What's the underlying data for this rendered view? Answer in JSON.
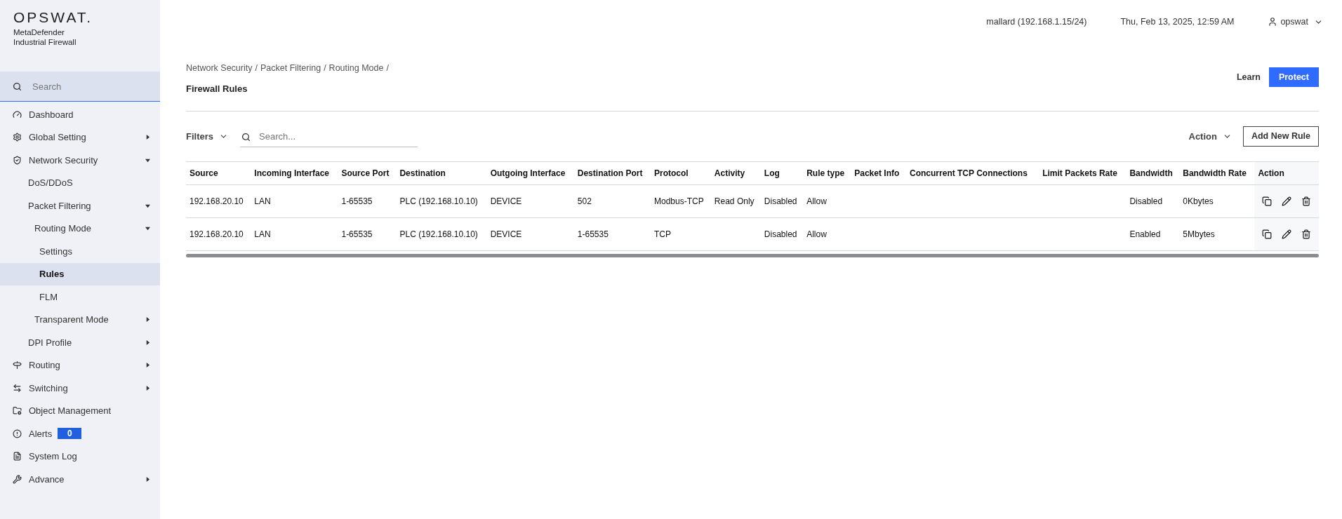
{
  "brand": {
    "logo": "OPSWAT.",
    "product": [
      "MetaDefender",
      "Industrial Firewall"
    ]
  },
  "sidebar": {
    "search": {
      "placeholder": "Search"
    },
    "items": [
      {
        "label": "Dashboard",
        "selected": false
      },
      {
        "label": "Global Setting",
        "selected": false,
        "expanded": false
      },
      {
        "label": "Network Security",
        "selected": false,
        "expanded": true,
        "children": [
          {
            "label": "DoS/DDoS",
            "selected": false
          },
          {
            "label": "Packet Filtering",
            "selected": false,
            "expanded": true,
            "children": [
              {
                "label": "Routing Mode",
                "selected": false,
                "expanded": true,
                "children": [
                  {
                    "label": "Settings",
                    "selected": false
                  },
                  {
                    "label": "Rules",
                    "selected": true
                  },
                  {
                    "label": "FLM",
                    "selected": false
                  }
                ]
              },
              {
                "label": "Transparent Mode",
                "selected": false,
                "expanded": false
              }
            ]
          },
          {
            "label": "DPI Profile",
            "selected": false,
            "expanded": false
          }
        ]
      },
      {
        "label": "Routing",
        "selected": false,
        "expanded": false
      },
      {
        "label": "Switching",
        "selected": false,
        "expanded": false
      },
      {
        "label": "Object Management",
        "selected": false
      },
      {
        "label": "Alerts",
        "selected": false,
        "badge": "0"
      },
      {
        "label": "System Log",
        "selected": false
      },
      {
        "label": "Advance",
        "selected": false,
        "expanded": false
      }
    ]
  },
  "header": {
    "host": "mallard (192.168.1.15/24)",
    "datetime": "Thu, Feb 13, 2025, 12:59 AM",
    "user": "opswat"
  },
  "breadcrumb": [
    "Network Security",
    "Packet Filtering",
    "Routing Mode"
  ],
  "breadcrumb_separator": "/",
  "page_title": "Firewall Rules",
  "buttons": {
    "learn": "Learn",
    "protect": "Protect"
  },
  "toolbar": {
    "filters": "Filters",
    "search": {
      "placeholder": "Search..."
    },
    "action": "Action",
    "add": "Add New Rule"
  },
  "table": {
    "columns": [
      "Source",
      "Incoming Interface",
      "Source Port",
      "Destination",
      "Outgoing Interface",
      "Destination Port",
      "Protocol",
      "Activity",
      "Log",
      "Rule type",
      "Packet Info",
      "Concurrent TCP Connections",
      "Limit Packets Rate",
      "Bandwidth",
      "Bandwidth Rate",
      "Action"
    ],
    "rows": [
      [
        "192.168.20.10",
        "LAN",
        "1-65535",
        "PLC (192.168.10.10)",
        "DEVICE",
        "502",
        "Modbus-TCP",
        "Read Only",
        "Disabled",
        "Allow",
        "",
        "",
        "",
        "Disabled",
        "0Kbytes"
      ],
      [
        "192.168.20.10",
        "LAN",
        "1-65535",
        "PLC (192.168.10.10)",
        "DEVICE",
        "1-65535",
        "TCP",
        "",
        "Disabled",
        "Allow",
        "",
        "",
        "",
        "Enabled",
        "5Mbytes"
      ]
    ]
  }
}
